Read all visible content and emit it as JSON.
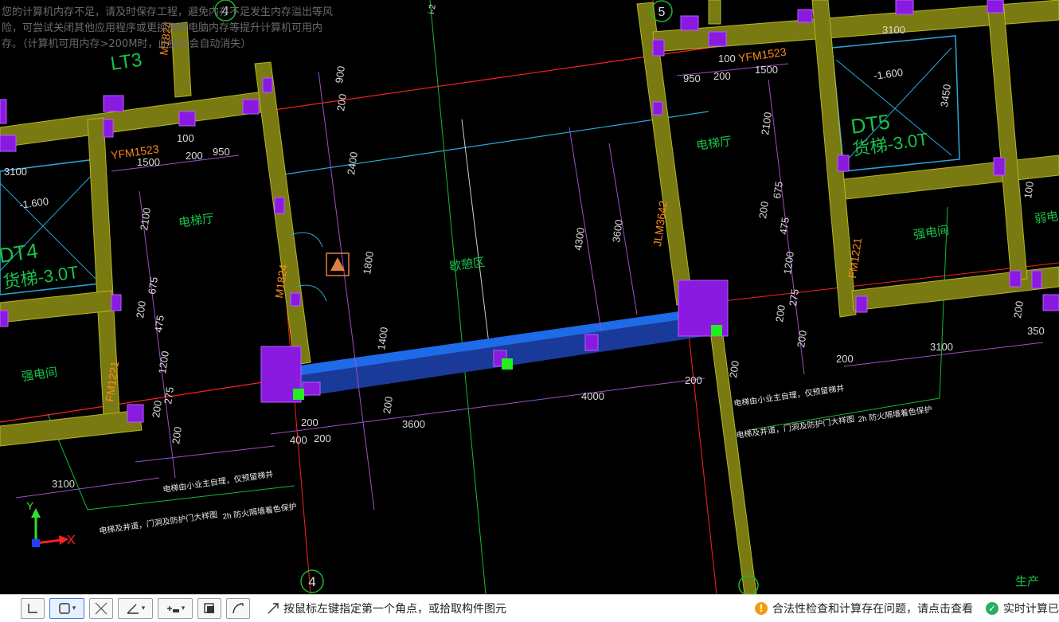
{
  "warning": {
    "line1": "您的计算机内存不足，请及时保存工程，避免内存不足发生内存溢出等风",
    "line2": "险，可尝试关闭其他应用程序或更换高配电脑内存等提升计算机可用内",
    "line3": "存。（计算机可用内存>200M时，此提示会自动消失）"
  },
  "cad": {
    "axes": {
      "top4": "4",
      "top5": "5",
      "bottom4": "4",
      "top_i2": "i-2"
    },
    "rooms": {
      "elevator_hall_left": "电梯厅",
      "elevator_hall_right": "电梯厅",
      "rest_area": "歇憩区",
      "elec_room_left": "强电间",
      "elec_room_right": "强电间",
      "weak_room": "弱电间",
      "dt4": "DT4",
      "dt4_load": "货梯-3.0T",
      "dt5": "DT5",
      "dt5_load": "货梯-3.0T",
      "lt3": "LT3",
      "production": "生产"
    },
    "doors": {
      "yfm_left": "YFM1523",
      "yfm_right": "YFM1523",
      "m1824_left": "M1824",
      "m1824_top": "M1824",
      "jlm": "JLM3642",
      "fm_left": "FM1221",
      "fm_right": "FM1221"
    },
    "levels": {
      "left": "-1.600",
      "right": "-1.600"
    },
    "dims": {
      "d100a": "100",
      "d200a": "200",
      "d950a": "950",
      "d1500a": "1500",
      "d3100a": "3100",
      "d2100a": "2100",
      "d675a": "675",
      "d200b": "200",
      "d475a": "475",
      "d1200a": "1200",
      "d275a": "275",
      "d200c": "200",
      "d200d": "200",
      "d3100b": "3100",
      "d900": "900",
      "d200e": "200",
      "d2400": "2400",
      "d1800": "1800",
      "d1400": "1400",
      "d4300": "4300",
      "d3600v": "3600",
      "d200f": "200",
      "d400": "400",
      "d200g": "200",
      "d200h": "200",
      "d3600": "3600",
      "d4000": "4000",
      "d200i": "200",
      "d200j": "200",
      "d100b": "100",
      "d200k": "200",
      "d950b": "950",
      "d1500b": "1500",
      "d2100b": "2100",
      "d675b": "675",
      "d200l": "200",
      "d475b": "475",
      "d1200b": "1200",
      "d275b": "275",
      "d200m": "200",
      "d200n": "200",
      "d3100c": "3100",
      "d3450": "3450",
      "d100c": "100",
      "d200o": "200",
      "d350": "350",
      "d3100d": "3100",
      "d200p": "200"
    },
    "notes": {
      "n1": "电梯由小业主自理，仅预留梯井",
      "n2": "电梯及井道，门洞及防护门大样图",
      "n3": "2h 防火隔墙着色保护",
      "n4": "电梯由小业主自理，仅预留梯井",
      "n5": "电梯及井道，门洞及防护门大样图",
      "n6": "2h 防火隔墙着色保护"
    },
    "ucs": {
      "x": "X",
      "y": "Y"
    }
  },
  "statusbar": {
    "tool_axis": "正交",
    "tool_rect": "矩形",
    "tool_cross": "交叉",
    "tool_angle": "角度",
    "tool_insert": "插入",
    "tool_doc": "文档",
    "tool_arc": "弧线",
    "hint": "按鼠标左键指定第一个角点，或拾取构件图元",
    "warning_msg": "合法性检查和计算存在问题，请点击查看",
    "realtime_msg": "实时计算已",
    "warn_color": "#f39c12",
    "ok_color": "#27ae60"
  }
}
